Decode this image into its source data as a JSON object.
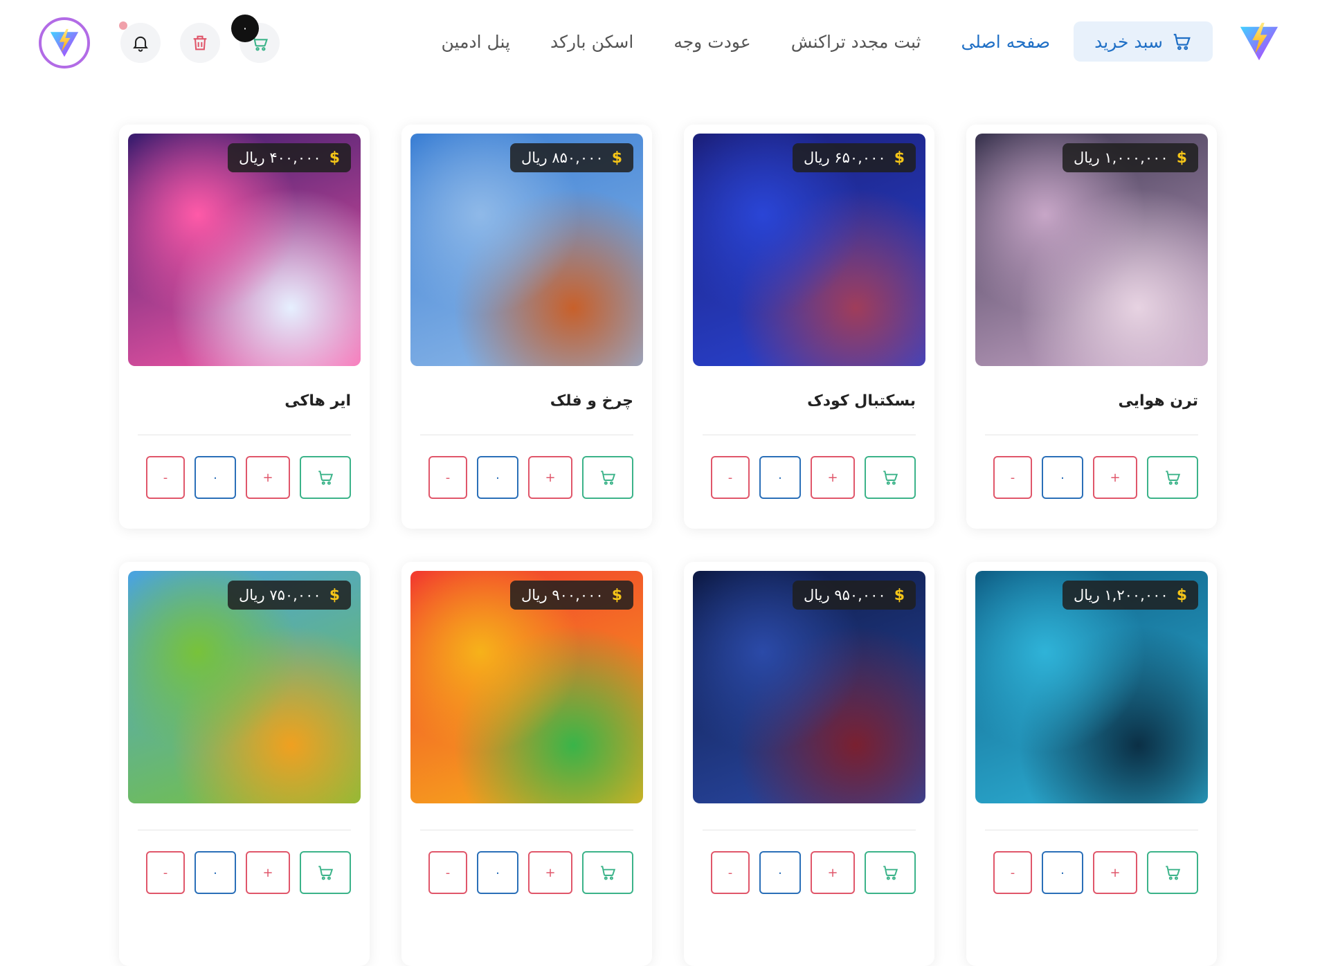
{
  "nav": {
    "cart_label": "سبد خرید",
    "links": [
      "صفحه اصلی",
      "ثبت مجدد تراکنش",
      "عودت وجه",
      "اسکن بارکد",
      "پنل ادمین"
    ],
    "cart_count": "۰"
  },
  "currency_symbol": "$",
  "products": [
    {
      "name": "ترن هوایی",
      "price": "۱,۰۰۰,۰۰۰ ریال",
      "qty": "۰",
      "theme": [
        "#3b3550",
        "#c7a6c7",
        "#e7d3e2"
      ]
    },
    {
      "name": "بسکتبال کودک",
      "price": "۶۵۰,۰۰۰ ریال",
      "qty": "۰",
      "theme": [
        "#1b1f7a",
        "#2a45d6",
        "#a03d5a"
      ]
    },
    {
      "name": "چرخ و فلک",
      "price": "۸۵۰,۰۰۰ ریال",
      "qty": "۰",
      "theme": [
        "#3b7fd4",
        "#8fb9e8",
        "#c8602a"
      ]
    },
    {
      "name": "ایر هاکی",
      "price": "۴۰۰,۰۰۰ ریال",
      "qty": "۰",
      "theme": [
        "#3a1c6e",
        "#ff5aa8",
        "#e6f0ff"
      ]
    },
    {
      "name": "",
      "price": "۱,۲۰۰,۰۰۰ ریال",
      "qty": "۰",
      "theme": [
        "#0f5f86",
        "#2fb3d8",
        "#0b2f45"
      ]
    },
    {
      "name": "",
      "price": "۹۵۰,۰۰۰ ریال",
      "qty": "۰",
      "theme": [
        "#0d1a45",
        "#2b4aa8",
        "#7a2030"
      ]
    },
    {
      "name": "",
      "price": "۹۰۰,۰۰۰ ریال",
      "qty": "۰",
      "theme": [
        "#f23b2e",
        "#f6b21a",
        "#39b449"
      ]
    },
    {
      "name": "",
      "price": "۷۵۰,۰۰۰ ریال",
      "qty": "۰",
      "theme": [
        "#4aa3e0",
        "#78c23a",
        "#f0a020"
      ]
    }
  ],
  "buttons": {
    "plus": "+",
    "minus": "-"
  },
  "colors": {
    "primary": "#1f6fc5",
    "success": "#3bb389",
    "danger": "#e0566a",
    "accent": "#b26be6"
  }
}
